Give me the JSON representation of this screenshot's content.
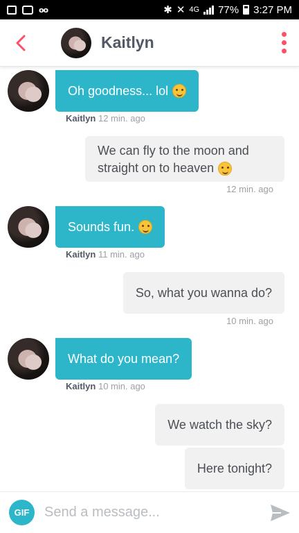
{
  "status_bar": {
    "signal_type": "4G",
    "battery": "77%",
    "time": "3:27 PM",
    "voicemail": "oo"
  },
  "header": {
    "name": "Kaitlyn",
    "back_icon": "chevron-left-icon",
    "menu_icon": "more-vertical-icon",
    "accent": "#fd5068"
  },
  "colors": {
    "incoming_bubble": "#2db6c9",
    "outgoing_bubble": "#f1f1f1"
  },
  "messages": [
    {
      "from": "them",
      "text": "Oh goodness... lol",
      "sender": "Kaitlyn",
      "time": "12 min. ago"
    },
    {
      "from": "me",
      "line1": "We can fly to the moon and",
      "line2": "straight on to heaven",
      "time": "12 min. ago"
    },
    {
      "from": "them",
      "text": "Sounds fun.",
      "sender": "Kaitlyn",
      "time": "11 min. ago"
    },
    {
      "from": "me",
      "text": "So, what you wanna do?",
      "time": "10 min. ago"
    },
    {
      "from": "them",
      "text": "What do you mean?",
      "sender": "Kaitlyn",
      "time": "10 min. ago"
    },
    {
      "from": "me",
      "text": "We watch the sky?"
    },
    {
      "from": "me",
      "text": "Here tonight?"
    }
  ],
  "composer": {
    "gif_label": "GIF",
    "placeholder": "Send a message...",
    "send_icon": "send-icon"
  }
}
